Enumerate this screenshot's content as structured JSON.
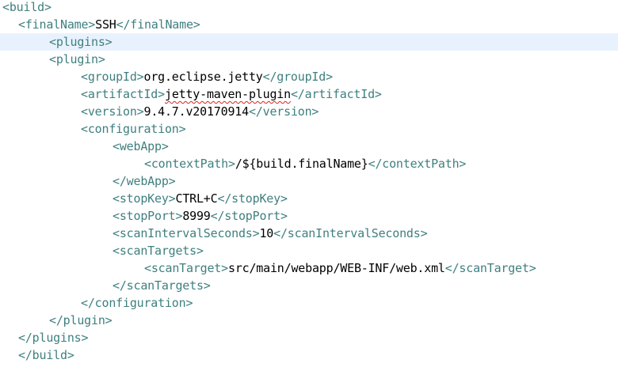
{
  "lines": [
    {
      "open": "<build>",
      "text": "",
      "close": ""
    },
    {
      "open": "<finalName>",
      "text": "SSH",
      "close": "</finalName>"
    },
    {
      "open": "<plugins>",
      "text": "",
      "close": ""
    },
    {
      "open": "<plugin>",
      "text": "",
      "close": ""
    },
    {
      "open": "<groupId>",
      "text": "org.eclipse.jetty",
      "close": "</groupId>"
    },
    {
      "open": "<artifactId>",
      "text": "jetty-maven-plugin",
      "close": "</artifactId>"
    },
    {
      "open": "<version>",
      "text": "9.4.7.v20170914",
      "close": "</version>"
    },
    {
      "open": "<configuration>",
      "text": "",
      "close": ""
    },
    {
      "open": "<webApp>",
      "text": "",
      "close": ""
    },
    {
      "open": "<contextPath>",
      "text": "/${build.finalName}",
      "close": "</contextPath>"
    },
    {
      "open": "</webApp>",
      "text": "",
      "close": ""
    },
    {
      "open": "<stopKey>",
      "text": "CTRL+C",
      "close": "</stopKey>"
    },
    {
      "open": "<stopPort>",
      "text": "8999",
      "close": "</stopPort>"
    },
    {
      "open": "<scanIntervalSeconds>",
      "text": "10",
      "close": "</scanIntervalSeconds>"
    },
    {
      "open": "<scanTargets>",
      "text": "",
      "close": ""
    },
    {
      "open": "<scanTarget>",
      "text": "src/main/webapp/WEB-INF/web.xml",
      "close": "</scanTarget>"
    },
    {
      "open": "</scanTargets>",
      "text": "",
      "close": ""
    },
    {
      "open": "</configuration>",
      "text": "",
      "close": ""
    },
    {
      "open": "</plugin>",
      "text": "",
      "close": ""
    },
    {
      "open": "</plugins>",
      "text": "",
      "close": ""
    },
    {
      "open": "</build>",
      "text": "",
      "close": ""
    }
  ],
  "colors": {
    "tag": "#3f7f7f",
    "text": "#000000",
    "current_line": "#e8f2fe",
    "spell_error": "#e02020"
  }
}
